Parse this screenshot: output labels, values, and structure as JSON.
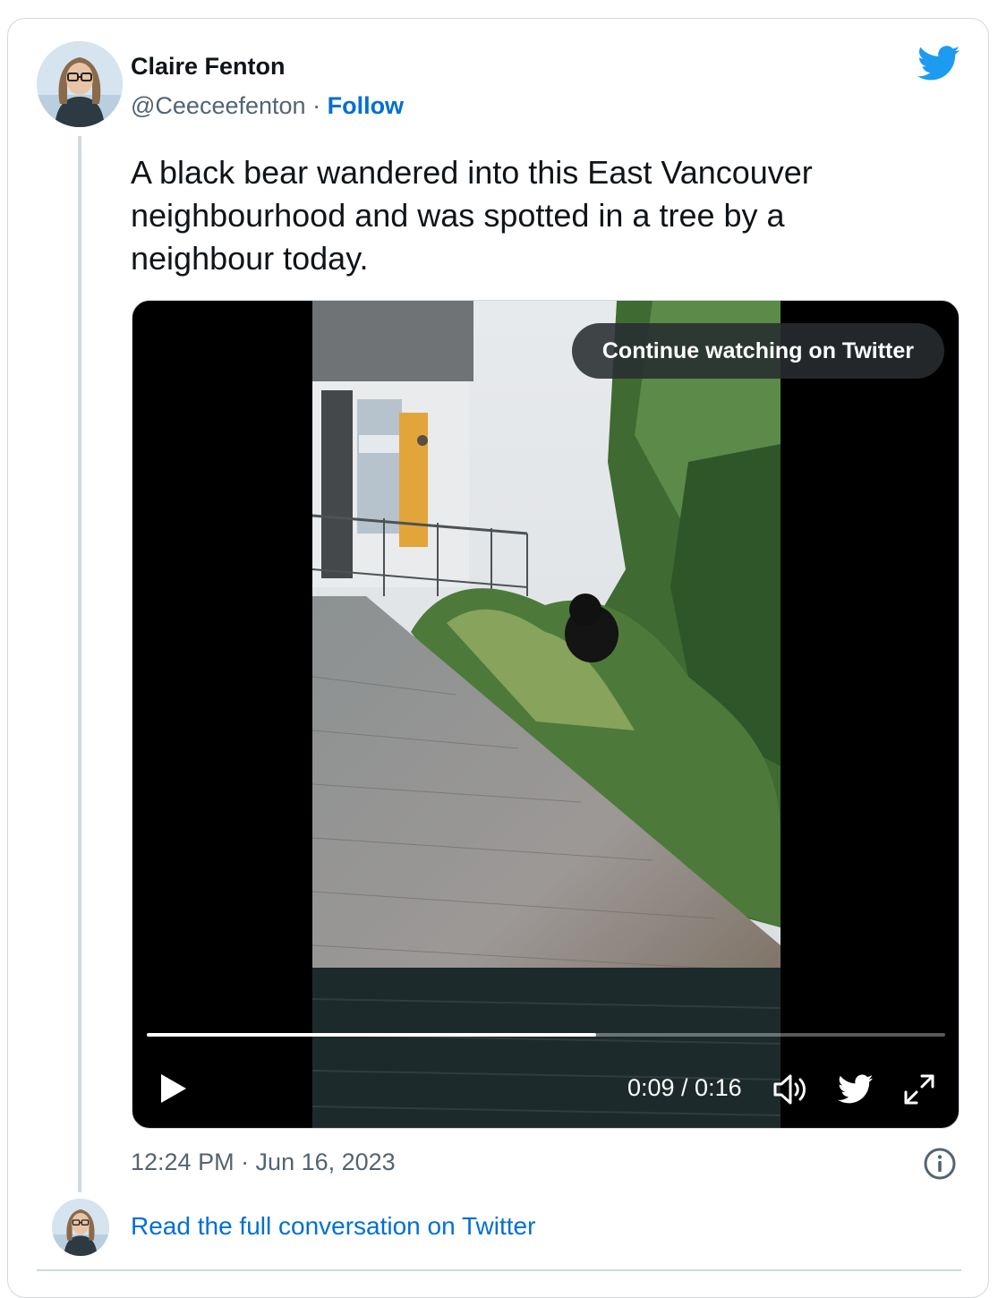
{
  "author": {
    "name": "Claire Fenton",
    "handle": "@Ceeceefenton",
    "separator": "·",
    "follow_label": "Follow"
  },
  "tweet": {
    "text": "A black bear wandered into this East Vancouver neighbourhood and was spotted in a tree by a neighbour today.",
    "timestamp": "12:24 PM · Jun 16, 2023"
  },
  "video": {
    "overlay_label": "Continue watching on Twitter",
    "time_display": "0:09 / 0:16",
    "progress_fraction": 0.5625,
    "controls": [
      "play-icon",
      "volume-icon",
      "twitter-bird-icon",
      "fullscreen-icon"
    ]
  },
  "footer": {
    "read_full_label": "Read the full conversation on Twitter"
  },
  "colors": {
    "brand_blue": "#1d9bf0",
    "link_blue": "#006fd6",
    "secondary_text": "#536471",
    "border": "#cfd9de"
  },
  "icons": {
    "logo": "twitter-bird-icon",
    "info": "info-icon"
  }
}
